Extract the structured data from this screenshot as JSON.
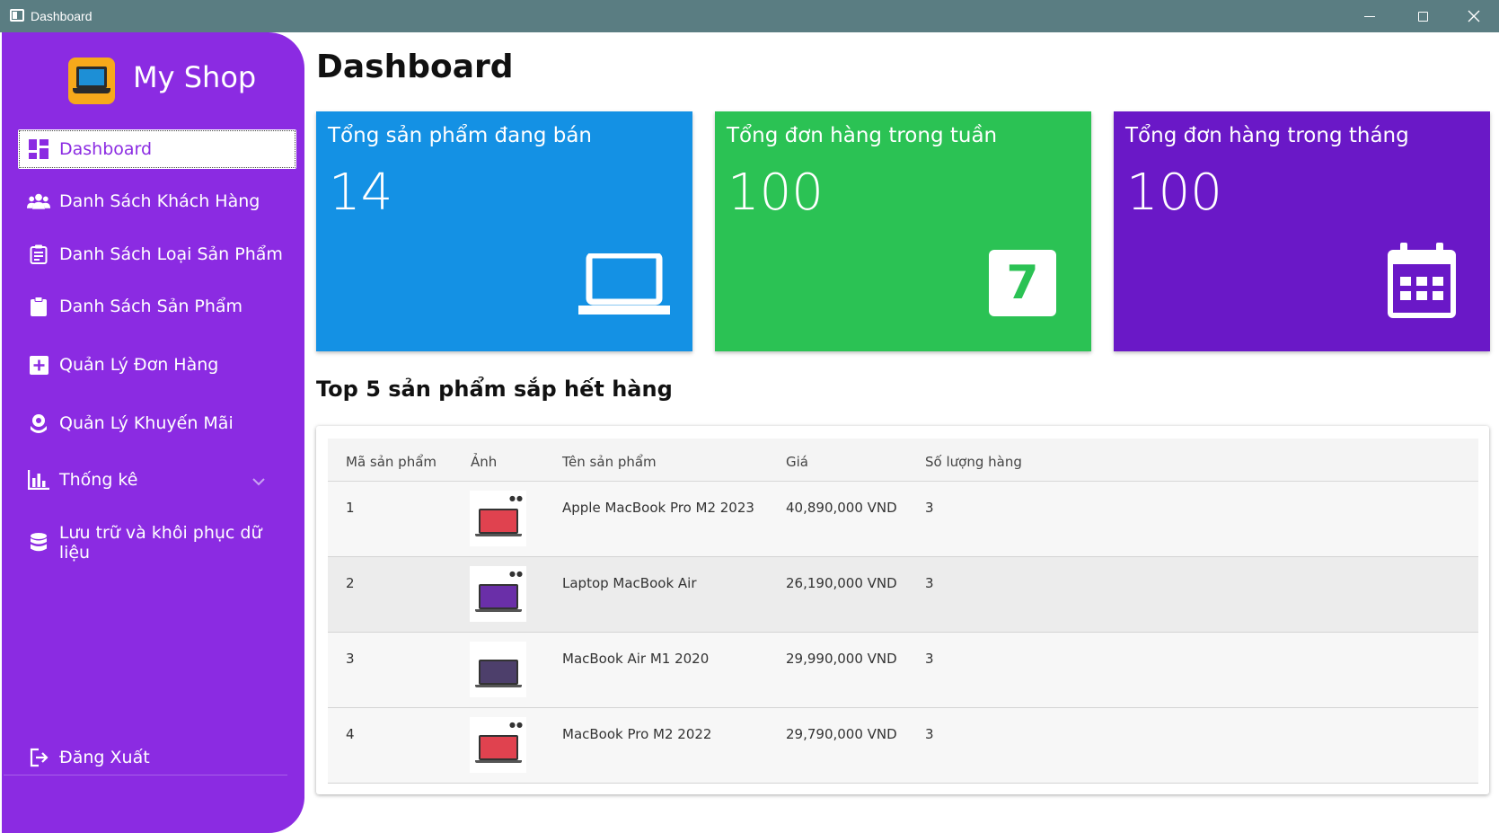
{
  "window": {
    "title": "Dashboard"
  },
  "sidebar": {
    "brand": "My Shop",
    "items": [
      {
        "label": "Dashboard",
        "icon": "dashboard-icon",
        "active": true
      },
      {
        "label": "Danh Sách Khách Hàng",
        "icon": "people-icon"
      },
      {
        "label": "Danh Sách Loại Sản Phẩm",
        "icon": "clipboard-list-icon"
      },
      {
        "label": "Danh Sách Sản Phẩm",
        "icon": "clipboard-icon"
      },
      {
        "label": "Quản Lý Đơn Hàng",
        "icon": "plus-square-icon"
      },
      {
        "label": "Quản Lý Khuyến Mãi",
        "icon": "promotion-icon"
      },
      {
        "label": "Thống kê",
        "icon": "bar-chart-icon",
        "expandable": true
      },
      {
        "label": "Lưu trữ và khôi phục dữ liệu",
        "icon": "database-icon"
      }
    ],
    "logout": {
      "label": "Đăng Xuất",
      "icon": "logout-icon"
    }
  },
  "main": {
    "title": "Dashboard",
    "cards": [
      {
        "label": "Tổng sản phẩm đang bán",
        "value": "14",
        "icon": "laptop-icon",
        "color": "#1491e4"
      },
      {
        "label": "Tổng đơn hàng trong tuần",
        "value": "100",
        "icon": "week-7-icon",
        "icon_text": "7",
        "color": "#2bc254"
      },
      {
        "label": "Tổng đơn hàng trong tháng",
        "value": "100",
        "icon": "calendar-icon",
        "color": "#6a18c7"
      }
    ],
    "section_title": "Top 5 sản phẩm sắp hết hàng",
    "table": {
      "headers": [
        "Mã sản phẩm",
        "Ảnh",
        "Tên sản phẩm",
        "Giá",
        "Số lượng hàng"
      ],
      "rows": [
        {
          "id": "1",
          "name": "Apple MacBook Pro M2 2023",
          "price": "40,890,000 VND",
          "qty": "3",
          "screen": "#e0424f"
        },
        {
          "id": "2",
          "name": "Laptop MacBook Air",
          "price": "26,190,000 VND",
          "qty": "3",
          "screen": "#6a2fa8"
        },
        {
          "id": "3",
          "name": "MacBook Air M1 2020",
          "price": "29,990,000 VND",
          "qty": "3",
          "screen": "#4d3f6b"
        },
        {
          "id": "4",
          "name": "MacBook Pro M2 2022",
          "price": "29,790,000 VND",
          "qty": "3",
          "screen": "#e0424f"
        }
      ]
    }
  },
  "colors": {
    "sidebar": "#8b2be2",
    "titlebar": "#5a7d82"
  }
}
